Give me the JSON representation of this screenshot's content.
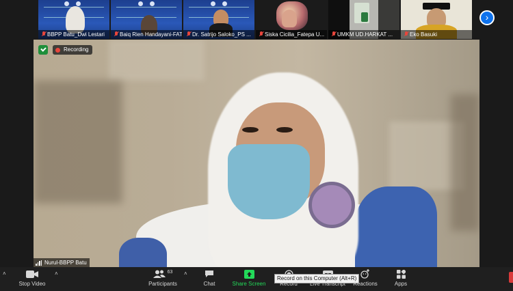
{
  "participants_strip": [
    {
      "name": "BBPP Batu_Dwi Lestari",
      "muted": true
    },
    {
      "name": "Baiq Rien Handayani-FAT...",
      "muted": true
    },
    {
      "name": "Dr. Satrijo Saloko_PS ...",
      "muted": true
    },
    {
      "name": "Siska Cicilia_Fatepa U...",
      "muted": true
    },
    {
      "name": "UMKM UD.HARKAT ...",
      "muted": true
    },
    {
      "name": "Eko Basuki",
      "muted": true
    }
  ],
  "main_video": {
    "recording_label": "Recording",
    "speaker_name": "Nurul-BBPP Batu"
  },
  "toolbar": {
    "stop_video": "Stop Video",
    "participants": "Participants",
    "participants_count": "63",
    "chat": "Chat",
    "share_screen": "Share Screen",
    "record": "Record",
    "live_transcript": "Live Transcript",
    "reactions": "Reactions",
    "apps": "Apps"
  },
  "tooltip": "Record on this Computer (Alt+R)",
  "colors": {
    "share_green": "#23d959",
    "accent_blue": "#0e72ed",
    "mute_red": "#e8463c"
  }
}
